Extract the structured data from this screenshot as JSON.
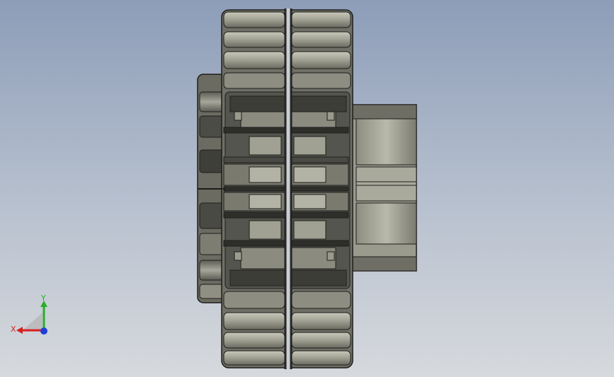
{
  "viewport": {
    "background_top": "#8d9db8",
    "background_bottom": "#d6d9dd"
  },
  "model": {
    "body_color": "#6f6f66",
    "rib_color": "#a3a395",
    "rib_light": "#c7c7b8",
    "shadow_color": "#3c3c37",
    "outline_color": "#1e1e1c"
  },
  "triad": {
    "x_label": "X",
    "y_label": "Y",
    "x_color": "#d62020",
    "y_color": "#25b025",
    "z_color": "#1f3fd6"
  }
}
